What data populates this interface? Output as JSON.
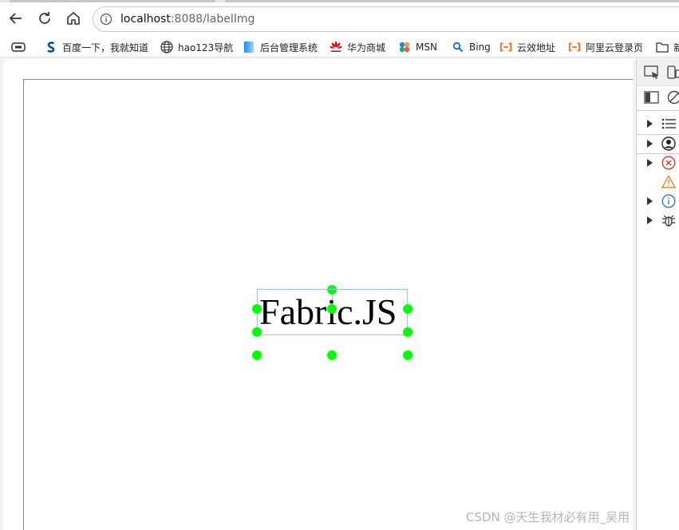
{
  "browser": {
    "url_host": "localhost",
    "url_rest": ":8088/labelImg"
  },
  "bookmarks": [
    {
      "label": "百度一下，我就知道",
      "icon": "baidu-icon"
    },
    {
      "label": "hao123导航",
      "icon": "globe-icon"
    },
    {
      "label": "后台管理系统",
      "icon": "app-icon"
    },
    {
      "label": "华为商城",
      "icon": "huawei-icon"
    },
    {
      "label": "MSN",
      "icon": "msn-icon"
    },
    {
      "label": "Bing",
      "icon": "search-icon"
    },
    {
      "label": "云效地址",
      "icon": "aliyun-icon"
    },
    {
      "label": "阿里云登录页",
      "icon": "aliyun-icon"
    },
    {
      "label": "新",
      "icon": "folder-icon"
    }
  ],
  "canvas": {
    "object_text": "Fabric.JS"
  },
  "watermark": "CSDN @天生我材必有用_吴用",
  "colors": {
    "handle": "#00ff00",
    "canvas_border": "#46a1d6",
    "selection_border": "#9ec2e6"
  }
}
